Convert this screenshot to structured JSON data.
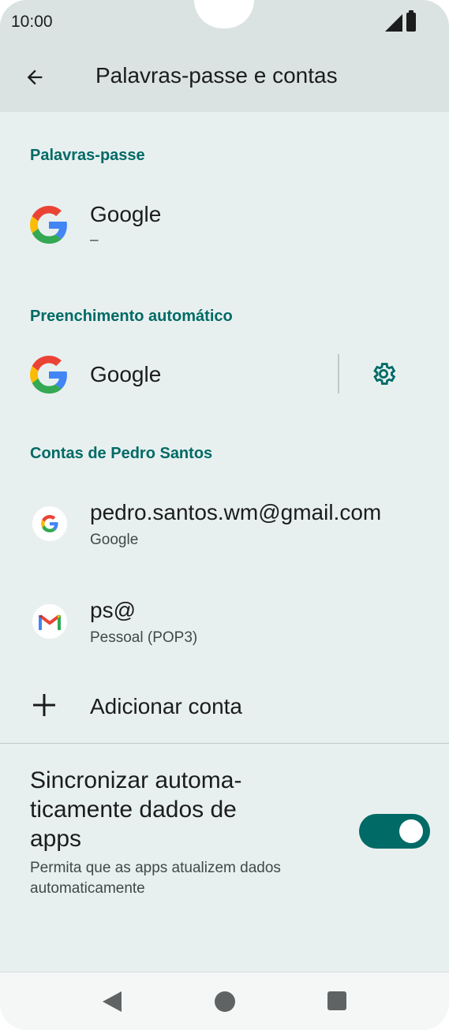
{
  "status_bar": {
    "time": "10:00"
  },
  "header": {
    "title": "Palavras-passe e contas"
  },
  "sections": {
    "passwords": {
      "title": "Palavras-passe",
      "item": {
        "title": "Google",
        "subtitle": "–"
      }
    },
    "autofill": {
      "title": "Preenchimento automático",
      "item": {
        "title": "Google"
      }
    },
    "accounts": {
      "title": "Contas de Pedro Santos",
      "items": [
        {
          "title": "pedro.santos.wm@gmail.com",
          "subtitle": "Google",
          "icon": "google-icon"
        },
        {
          "title": "ps@",
          "subtitle": "Pessoal (POP3)",
          "icon": "gmail-icon"
        }
      ],
      "add_label": "Adicionar conta"
    }
  },
  "sync": {
    "title": "Sincronizar automa-ticamente dados de apps",
    "title_line1": "Sincronizar automa-",
    "title_line2": "ticamente dados de",
    "title_line3": "apps",
    "subtitle_line1": "Permita que as apps atualizem dados",
    "subtitle_line2": "automaticamente",
    "enabled": true
  },
  "colors": {
    "accent": "#006a66",
    "background": "#e8f0ef",
    "header": "#dae3e2"
  }
}
